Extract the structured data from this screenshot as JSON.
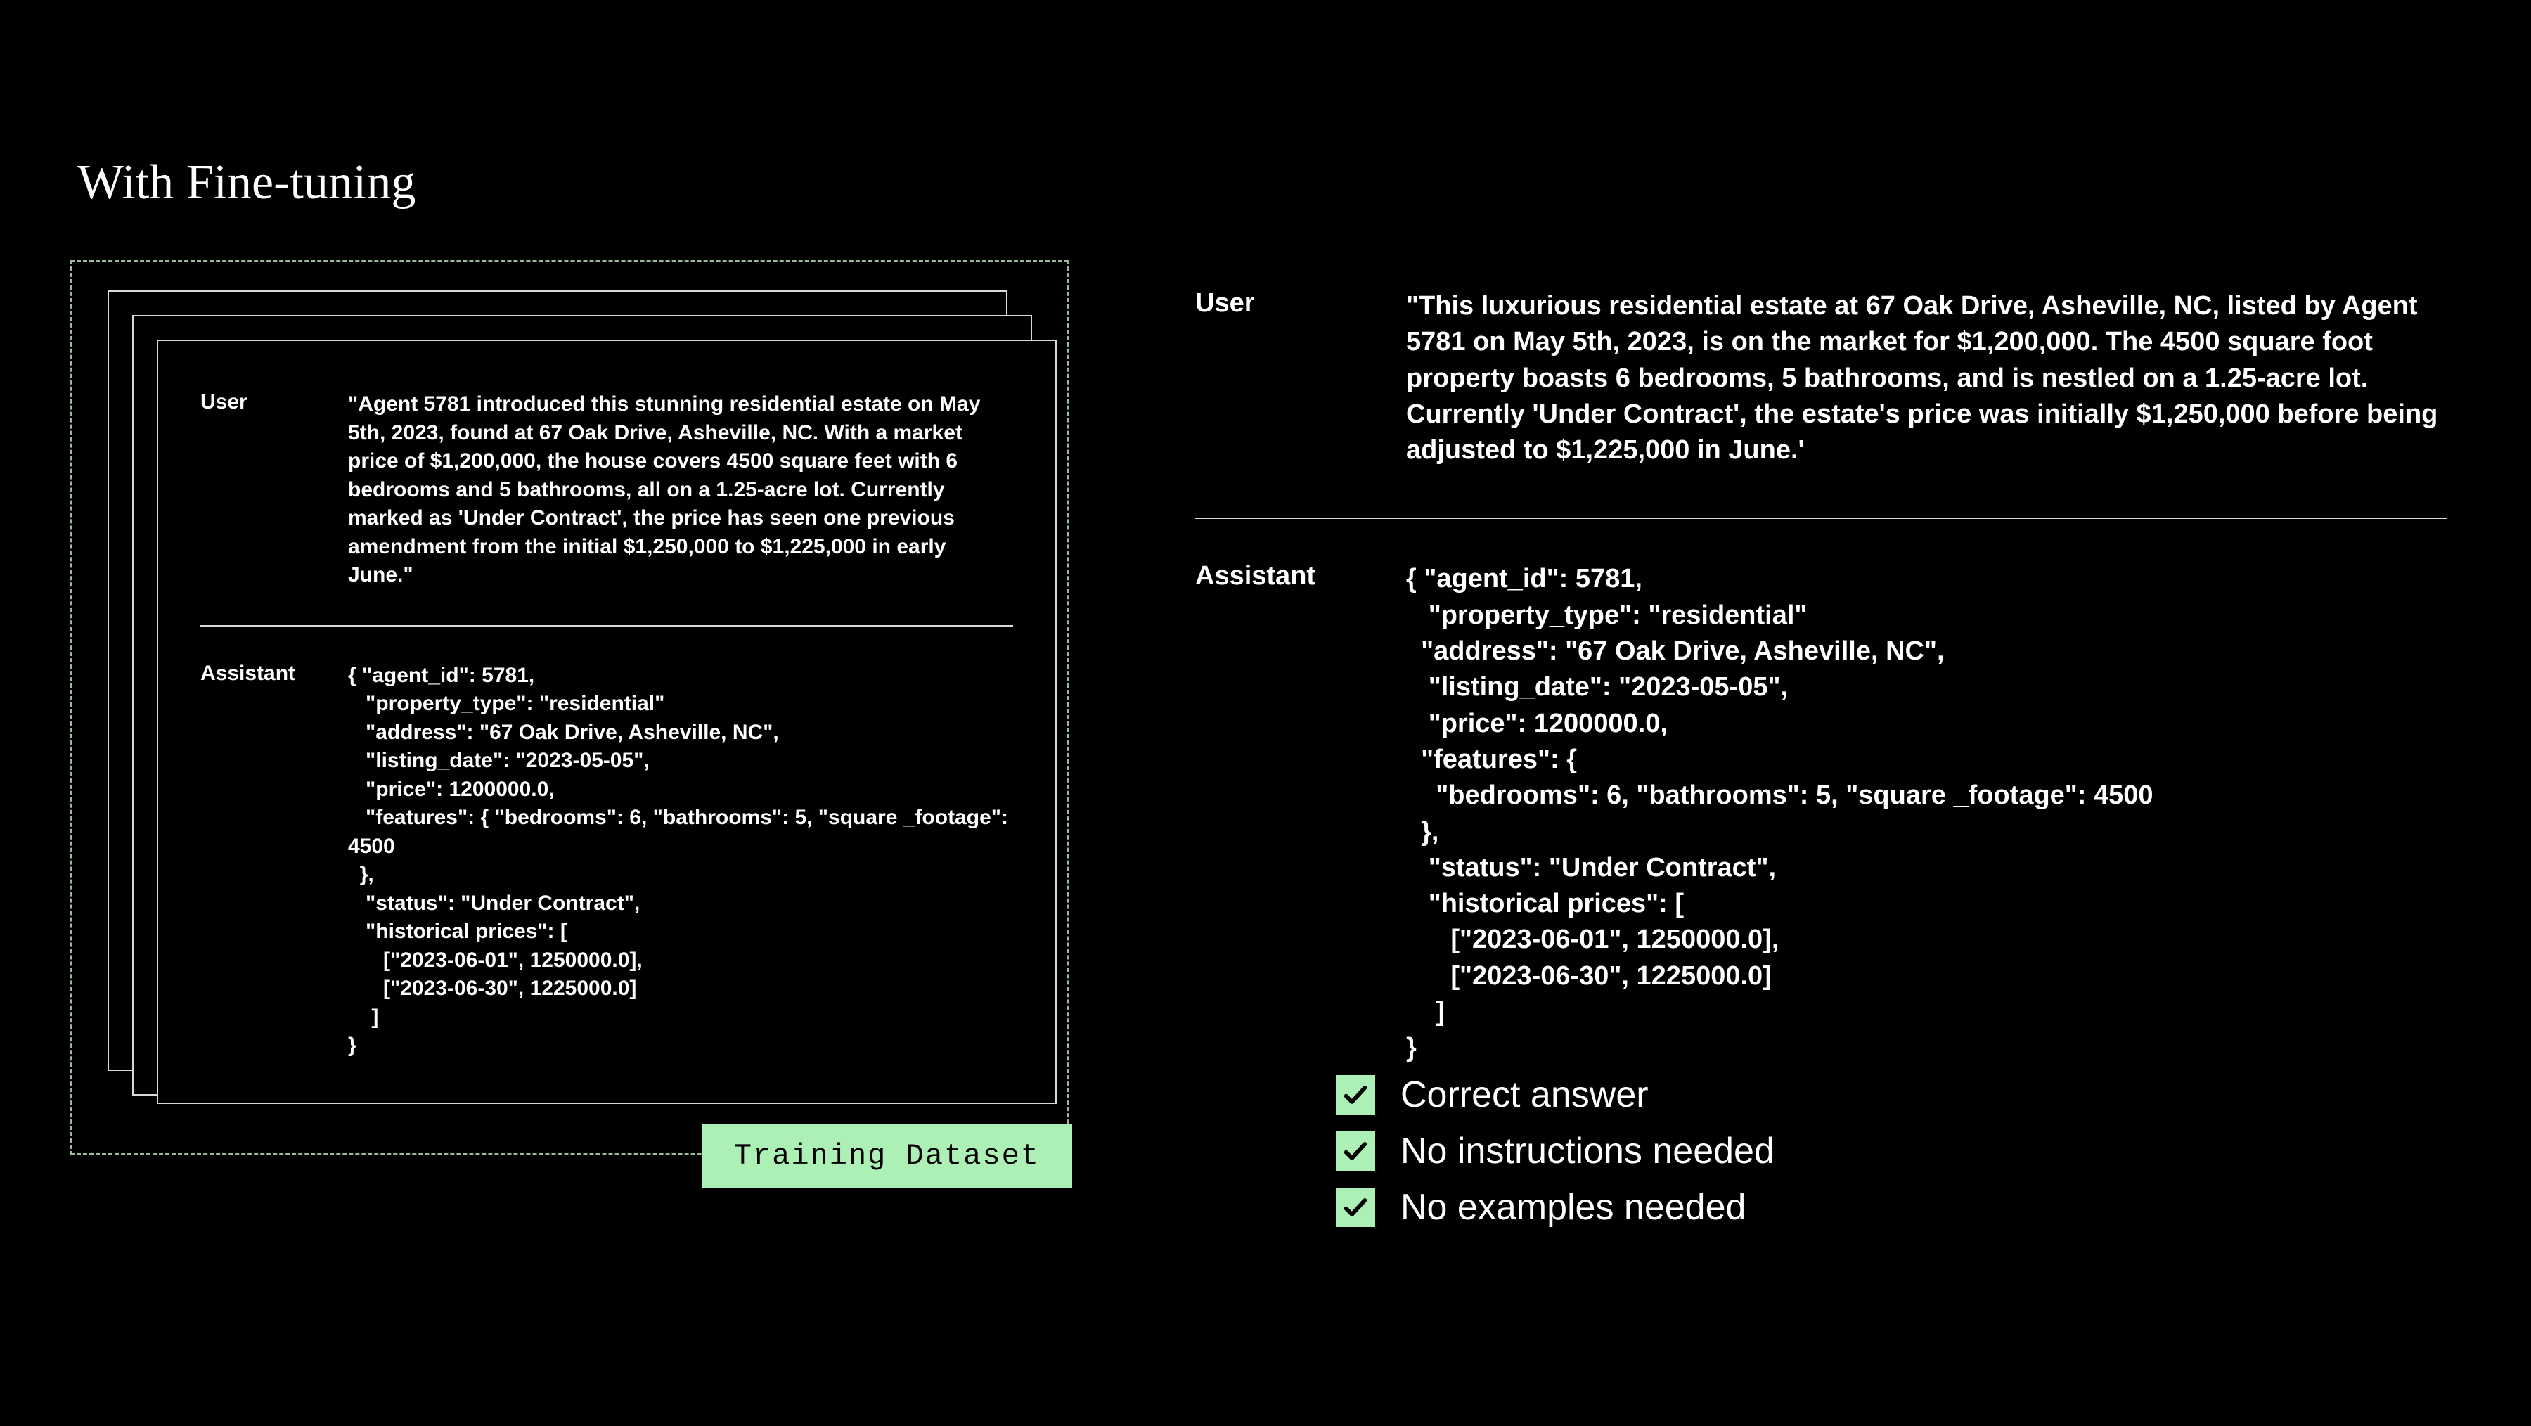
{
  "title": "With Fine-tuning",
  "training_label": "Training Dataset",
  "left": {
    "user_role": "User",
    "user_text": "\"Agent 5781 introduced this stunning residential estate on May 5th, 2023, found at 67 Oak Drive, Asheville, NC. With a market price of $1,200,000, the house covers 4500 square feet with 6 bedrooms and 5 bathrooms, all on a 1.25-acre lot. Currently marked as 'Under Contract', the price has seen one previous amendment from the initial $1,250,000 to $1,225,000 in early June.\"",
    "assistant_role": "Assistant",
    "assistant_text": "{ \"agent_id\": 5781,\n   \"property_type\": \"residential\"\n   \"address\": \"67 Oak Drive, Asheville, NC\",\n   \"listing_date\": \"2023-05-05\",\n   \"price\": 1200000.0,\n   \"features\": { \"bedrooms\": 6, \"bathrooms\": 5, \"square _footage\": 4500\n  },\n   \"status\": \"Under Contract\",\n   \"historical prices\": [\n      [\"2023-06-01\", 1250000.0],\n      [\"2023-06-30\", 1225000.0]\n    ]\n}"
  },
  "right": {
    "user_role": "User",
    "user_text": "\"This luxurious residential estate at 67 Oak Drive, Asheville, NC, listed by Agent 5781 on May 5th, 2023, is on the market for $1,200,000. The 4500 square foot property boasts 6 bedrooms, 5 bathrooms, and is nestled on a 1.25-acre lot. Currently 'Under Contract', the estate's price was initially $1,250,000 before being adjusted to $1,225,000 in June.'",
    "assistant_role": "Assistant",
    "assistant_text": "{ \"agent_id\": 5781,\n   \"property_type\": \"residential\"\n  \"address\": \"67 Oak Drive, Asheville, NC\",\n   \"listing_date\": \"2023-05-05\",\n   \"price\": 1200000.0,\n  \"features\": {\n    \"bedrooms\": 6, \"bathrooms\": 5, \"square _footage\": 4500\n  },\n   \"status\": \"Under Contract\",\n   \"historical prices\": [\n      [\"2023-06-01\", 1250000.0],\n      [\"2023-06-30\", 1225000.0]\n    ]\n}"
  },
  "checks": {
    "item1": "Correct answer",
    "item2": "No instructions needed",
    "item3": "No examples needed"
  }
}
